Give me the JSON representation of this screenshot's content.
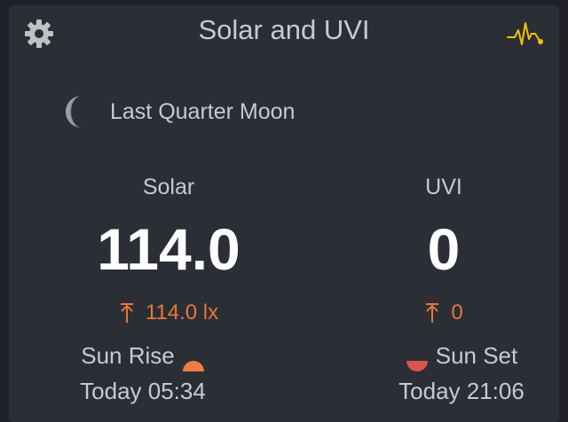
{
  "header": {
    "title": "Solar and UVI",
    "settings_icon": "gear-icon",
    "graph_icon": "pulse-graph-icon"
  },
  "moon": {
    "icon": "last-quarter-moon-icon",
    "label": "Last Quarter Moon"
  },
  "solar": {
    "label": "Solar",
    "value": "114.0",
    "max": "114.0 lx",
    "max_icon": "max-arrow-icon"
  },
  "uvi": {
    "label": "UVI",
    "value": "0",
    "max": "0",
    "max_icon": "max-arrow-icon"
  },
  "sunrise": {
    "label": "Sun Rise",
    "time": "Today 05:34",
    "icon": "sunrise-icon"
  },
  "sunset": {
    "label": "Sun Set",
    "time": "Today 21:06",
    "icon": "sunset-icon"
  },
  "colors": {
    "background": "#1f2126",
    "card": "#2b2e35",
    "text": "#c8cacd",
    "value": "#ffffff",
    "accent_orange": "#e8763a",
    "sun_rise": "#f07c45",
    "sun_set": "#d9534f",
    "graph_icon": "#f2c200",
    "gear": "#bfc1c4"
  }
}
